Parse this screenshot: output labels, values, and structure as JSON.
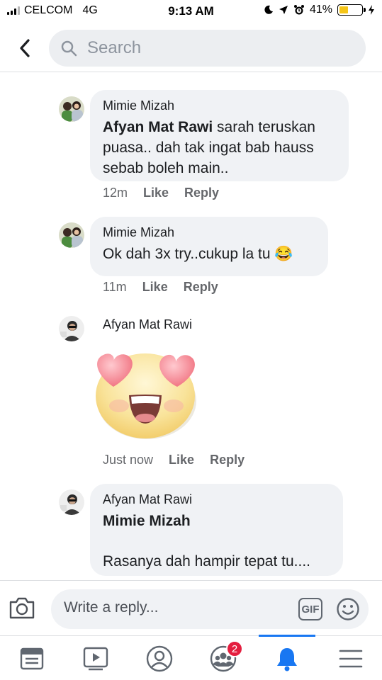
{
  "status_bar": {
    "carrier": "CELCOM",
    "network": "4G",
    "time": "9:13 AM",
    "battery_percent": "41%",
    "battery_level": 0.41,
    "battery_color": "#f5c518"
  },
  "header": {
    "back_icon": "chevron-left-icon",
    "search_placeholder": "Search",
    "search_icon": "search-icon"
  },
  "comments": [
    {
      "author": "Mimie Mizah",
      "mention": "Afyan Mat Rawi",
      "text": "sarah teruskan puasa.. dah tak ingat bab hauss sebab boleh main..",
      "time": "12m",
      "like_label": "Like",
      "reply_label": "Reply"
    },
    {
      "author": "Mimie Mizah",
      "text": "Ok dah 3x try..cukup la tu 😂",
      "time": "11m",
      "like_label": "Like",
      "reply_label": "Reply"
    },
    {
      "author": "Afyan Mat Rawi",
      "sticker": "heart-eyes-emoji-sticker",
      "time": "Just now",
      "like_label": "Like",
      "reply_label": "Reply"
    },
    {
      "author": "Afyan Mat Rawi",
      "mention": "Mimie Mizah",
      "text": "Rasanya dah hampir tepat tu...."
    }
  ],
  "reply_bar": {
    "placeholder": "Write a reply...",
    "gif_label": "GIF",
    "camera_icon": "camera-icon",
    "emoji_icon": "smiley-icon"
  },
  "tab_bar": {
    "tabs": [
      "news-feed",
      "watch",
      "profile",
      "groups",
      "notifications",
      "menu"
    ],
    "active_tab": "notifications",
    "groups_badge": "2",
    "accent_color": "#1877f2",
    "badge_color": "#e41e3f"
  }
}
